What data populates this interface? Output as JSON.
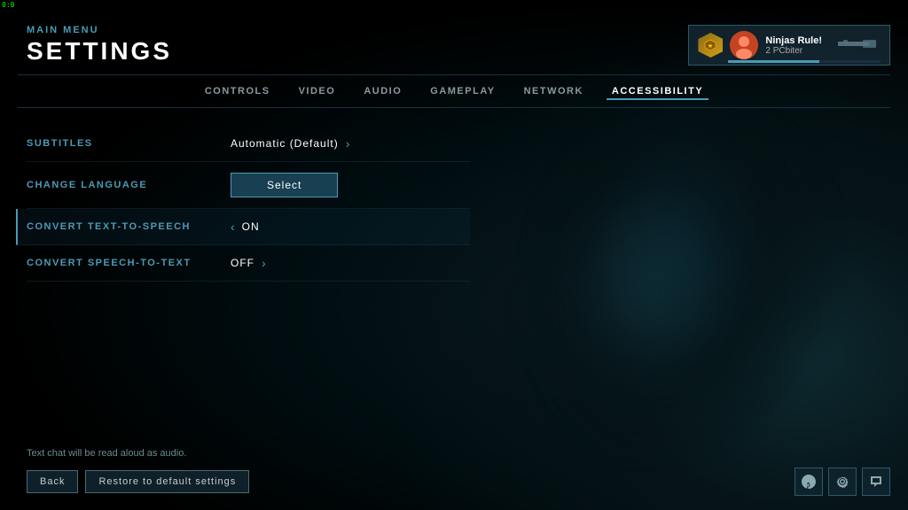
{
  "corner": "0:0",
  "header": {
    "breadcrumb": "MAIN MENU",
    "title": "SETTINGS"
  },
  "player": {
    "name": "Ninjas Rule!",
    "sub": "2 PCbiter",
    "rank_color": "#D4A017"
  },
  "nav": {
    "tabs": [
      {
        "id": "controls",
        "label": "CONTROLS",
        "active": false
      },
      {
        "id": "video",
        "label": "VIDEO",
        "active": false
      },
      {
        "id": "audio",
        "label": "AUDIO",
        "active": false
      },
      {
        "id": "gameplay",
        "label": "GAMEPLAY",
        "active": false
      },
      {
        "id": "network",
        "label": "NETWORK",
        "active": false
      },
      {
        "id": "accessibility",
        "label": "ACCESSIBILITY",
        "active": true
      }
    ]
  },
  "settings": {
    "rows": [
      {
        "id": "subtitles",
        "label": "SUBTITLES",
        "value": "Automatic (Default)",
        "has_right_arrow": true,
        "has_left_arrow": false,
        "has_select": false,
        "active": false
      },
      {
        "id": "change-language",
        "label": "CHANGE LANGUAGE",
        "value": "",
        "has_right_arrow": false,
        "has_left_arrow": false,
        "has_select": true,
        "active": false
      },
      {
        "id": "convert-tts",
        "label": "CONVERT TEXT-TO-SPEECH",
        "value": "ON",
        "has_right_arrow": false,
        "has_left_arrow": true,
        "has_select": false,
        "active": true
      },
      {
        "id": "convert-stt",
        "label": "CONVERT SPEECH-TO-TEXT",
        "value": "OFF",
        "has_right_arrow": true,
        "has_left_arrow": false,
        "has_select": false,
        "active": false
      }
    ],
    "select_label": "Select"
  },
  "footer": {
    "note": "Text chat will be read aloud as audio.",
    "back_label": "Back",
    "restore_label": "Restore to default settings"
  }
}
